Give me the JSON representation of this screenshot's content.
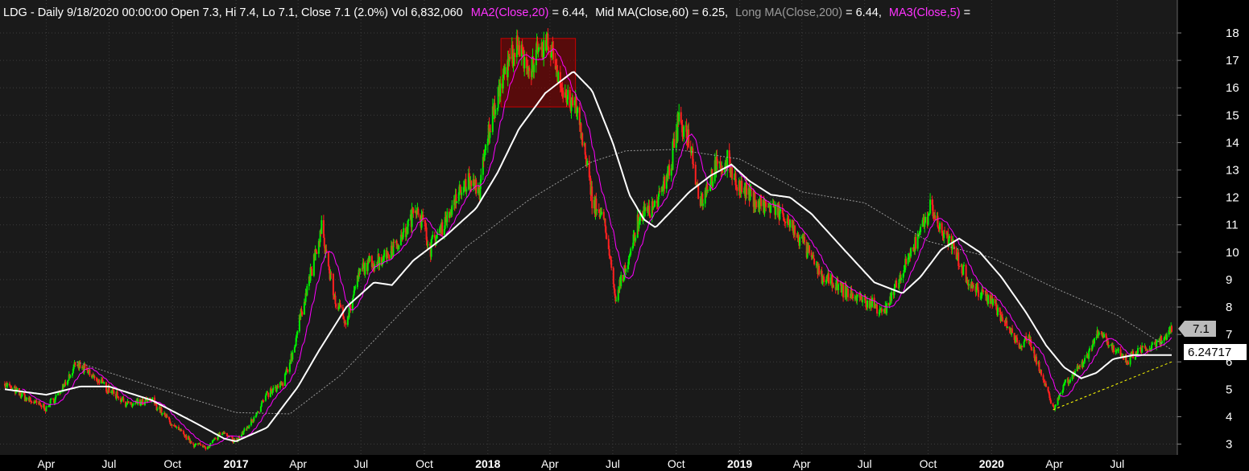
{
  "header": {
    "ticker_info": "LDG - Daily 9/18/2020 00:00:00 Open 7.3, Hi 7.4, Lo 7.1, Close 7.1 (2.0%) Vol 6,832,060",
    "ma2_label": "MA2(Close,20)",
    "ma2_value": " = 6.44,",
    "mid_label": "Mid MA(Close,60)",
    "mid_value": " = 6.25,",
    "long_label": "Long MA(Close,200)",
    "long_value": " = 6.44,",
    "ma3_label": "MA3(Close,5)",
    "ma3_value": " ="
  },
  "price_tags": {
    "last_close": "7.1",
    "mid_ma": "6.24717"
  },
  "colors": {
    "up_candle": "#00ee00",
    "down_candle": "#ff2020",
    "ma2": "#ff00ff",
    "mid_ma": "#ffffff",
    "long_ma": "#999999",
    "ma3": "#ff00ff",
    "trendline": "#ffff00",
    "highlight_box": "#aa0000"
  },
  "chart_data": {
    "type": "candlestick",
    "ylim": [
      2.6,
      18.6
    ],
    "y_ticks": [
      3,
      4,
      5,
      6,
      7,
      8,
      9,
      10,
      11,
      12,
      13,
      14,
      15,
      16,
      17,
      18
    ],
    "x_ticks": [
      "Apr",
      "Jul",
      "Oct",
      "2017",
      "Apr",
      "Jul",
      "Oct",
      "2018",
      "Apr",
      "Jul",
      "Oct",
      "2019",
      "Apr",
      "Jul",
      "Oct",
      "2020",
      "Apr",
      "Jul"
    ],
    "x_ticks_bold": [
      false,
      false,
      false,
      true,
      false,
      false,
      false,
      true,
      false,
      false,
      false,
      true,
      false,
      false,
      false,
      true,
      false,
      false
    ],
    "x_tick_dates": [
      "2016-04-01",
      "2016-07-01",
      "2016-10-01",
      "2017-01-01",
      "2017-04-01",
      "2017-07-01",
      "2017-10-01",
      "2018-01-01",
      "2018-04-01",
      "2018-07-01",
      "2018-10-01",
      "2019-01-01",
      "2019-04-01",
      "2019-07-01",
      "2019-10-01",
      "2020-01-01",
      "2020-04-01",
      "2020-07-01"
    ],
    "x_range": [
      "2016-02-01",
      "2020-09-18"
    ],
    "price_path": [
      [
        "2016-02-01",
        5.2
      ],
      [
        "2016-03-01",
        4.7
      ],
      [
        "2016-04-01",
        4.3
      ],
      [
        "2016-04-20",
        4.9
      ],
      [
        "2016-05-15",
        5.9
      ],
      [
        "2016-06-01",
        5.6
      ],
      [
        "2016-07-01",
        5.0
      ],
      [
        "2016-08-01",
        4.4
      ],
      [
        "2016-09-01",
        4.6
      ],
      [
        "2016-10-01",
        3.7
      ],
      [
        "2016-11-01",
        3.0
      ],
      [
        "2016-11-20",
        2.9
      ],
      [
        "2016-12-10",
        3.4
      ],
      [
        "2017-01-01",
        3.1
      ],
      [
        "2017-01-20",
        3.7
      ],
      [
        "2017-02-15",
        4.8
      ],
      [
        "2017-03-10",
        5.2
      ],
      [
        "2017-03-25",
        6.4
      ],
      [
        "2017-04-10",
        8.3
      ],
      [
        "2017-05-05",
        10.8
      ],
      [
        "2017-05-25",
        8.2
      ],
      [
        "2017-06-10",
        7.5
      ],
      [
        "2017-07-01",
        9.4
      ],
      [
        "2017-08-01",
        9.8
      ],
      [
        "2017-09-01",
        10.6
      ],
      [
        "2017-09-20",
        11.7
      ],
      [
        "2017-10-10",
        10.2
      ],
      [
        "2017-11-01",
        11.2
      ],
      [
        "2017-12-01",
        12.6
      ],
      [
        "2017-12-20",
        12.3
      ],
      [
        "2018-01-01",
        14.2
      ],
      [
        "2018-01-20",
        16.3
      ],
      [
        "2018-02-10",
        17.4
      ],
      [
        "2018-03-01",
        16.8
      ],
      [
        "2018-04-01",
        17.6
      ],
      [
        "2018-04-20",
        15.8
      ],
      [
        "2018-05-10",
        15.2
      ],
      [
        "2018-06-01",
        12.0
      ],
      [
        "2018-06-20",
        11.0
      ],
      [
        "2018-07-05",
        8.2
      ],
      [
        "2018-07-20",
        9.5
      ],
      [
        "2018-08-10",
        11.3
      ],
      [
        "2018-09-01",
        11.8
      ],
      [
        "2018-09-20",
        12.8
      ],
      [
        "2018-10-05",
        14.8
      ],
      [
        "2018-10-20",
        14.2
      ],
      [
        "2018-11-05",
        11.8
      ],
      [
        "2018-11-25",
        13.0
      ],
      [
        "2018-12-15",
        13.3
      ],
      [
        "2019-01-01",
        12.3
      ],
      [
        "2019-02-01",
        11.8
      ],
      [
        "2019-03-01",
        11.4
      ],
      [
        "2019-04-01",
        10.4
      ],
      [
        "2019-05-01",
        9.1
      ],
      [
        "2019-06-01",
        8.6
      ],
      [
        "2019-07-01",
        8.2
      ],
      [
        "2019-08-01",
        7.9
      ],
      [
        "2019-09-01",
        9.6
      ],
      [
        "2019-09-20",
        10.9
      ],
      [
        "2019-10-05",
        11.6
      ],
      [
        "2019-10-20",
        10.8
      ],
      [
        "2019-11-10",
        10.0
      ],
      [
        "2019-12-01",
        8.8
      ],
      [
        "2020-01-01",
        8.3
      ],
      [
        "2020-01-20",
        7.4
      ],
      [
        "2020-02-10",
        6.6
      ],
      [
        "2020-02-25",
        6.8
      ],
      [
        "2020-03-15",
        5.4
      ],
      [
        "2020-04-01",
        4.3
      ],
      [
        "2020-04-15",
        5.2
      ],
      [
        "2020-05-01",
        5.6
      ],
      [
        "2020-05-20",
        6.3
      ],
      [
        "2020-06-05",
        7.2
      ],
      [
        "2020-06-20",
        6.6
      ],
      [
        "2020-07-15",
        6.0
      ],
      [
        "2020-08-01",
        6.4
      ],
      [
        "2020-08-20",
        6.5
      ],
      [
        "2020-09-05",
        6.8
      ],
      [
        "2020-09-18",
        7.1
      ]
    ],
    "long_ma_path": [
      [
        "2016-05-15",
        6.0
      ],
      [
        "2016-09-01",
        5.1
      ],
      [
        "2017-01-01",
        4.15
      ],
      [
        "2017-03-20",
        4.1
      ],
      [
        "2017-06-01",
        5.5
      ],
      [
        "2017-09-01",
        7.9
      ],
      [
        "2017-12-01",
        10.2
      ],
      [
        "2018-03-01",
        11.9
      ],
      [
        "2018-06-01",
        13.3
      ],
      [
        "2018-07-20",
        13.7
      ],
      [
        "2018-10-01",
        13.75
      ],
      [
        "2019-01-01",
        13.4
      ],
      [
        "2019-04-01",
        12.2
      ],
      [
        "2019-07-01",
        11.8
      ],
      [
        "2019-10-01",
        10.4
      ],
      [
        "2020-01-01",
        9.8
      ],
      [
        "2020-04-01",
        8.7
      ],
      [
        "2020-07-01",
        7.7
      ],
      [
        "2020-09-18",
        6.44
      ]
    ],
    "mid_ma_path": [
      [
        "2016-02-01",
        5.0
      ],
      [
        "2016-04-01",
        4.8
      ],
      [
        "2016-05-20",
        5.1
      ],
      [
        "2016-07-01",
        5.1
      ],
      [
        "2016-09-01",
        4.6
      ],
      [
        "2016-11-01",
        3.8
      ],
      [
        "2016-12-15",
        3.2
      ],
      [
        "2017-01-01",
        3.1
      ],
      [
        "2017-02-15",
        3.6
      ],
      [
        "2017-04-01",
        5.1
      ],
      [
        "2017-05-01",
        6.4
      ],
      [
        "2017-06-10",
        8.0
      ],
      [
        "2017-07-20",
        8.9
      ],
      [
        "2017-08-15",
        8.8
      ],
      [
        "2017-09-15",
        9.7
      ],
      [
        "2017-11-01",
        10.6
      ],
      [
        "2017-12-15",
        11.6
      ],
      [
        "2018-01-15",
        12.9
      ],
      [
        "2018-02-15",
        14.5
      ],
      [
        "2018-03-25",
        15.8
      ],
      [
        "2018-05-05",
        16.6
      ],
      [
        "2018-06-01",
        15.9
      ],
      [
        "2018-07-01",
        14.0
      ],
      [
        "2018-07-25",
        12.1
      ],
      [
        "2018-08-15",
        11.2
      ],
      [
        "2018-09-01",
        10.9
      ],
      [
        "2018-09-20",
        11.4
      ],
      [
        "2018-10-20",
        12.2
      ],
      [
        "2018-11-20",
        12.8
      ],
      [
        "2018-12-20",
        13.2
      ],
      [
        "2019-01-15",
        12.6
      ],
      [
        "2019-02-15",
        12.1
      ],
      [
        "2019-03-15",
        12.0
      ],
      [
        "2019-04-15",
        11.4
      ],
      [
        "2019-06-01",
        10.1
      ],
      [
        "2019-07-15",
        8.9
      ],
      [
        "2019-08-25",
        8.5
      ],
      [
        "2019-09-20",
        9.1
      ],
      [
        "2019-10-20",
        10.1
      ],
      [
        "2019-11-15",
        10.5
      ],
      [
        "2019-12-15",
        10.0
      ],
      [
        "2020-01-15",
        9.1
      ],
      [
        "2020-02-20",
        7.8
      ],
      [
        "2020-03-20",
        6.6
      ],
      [
        "2020-04-15",
        5.8
      ],
      [
        "2020-05-10",
        5.4
      ],
      [
        "2020-06-01",
        5.6
      ],
      [
        "2020-06-25",
        6.1
      ],
      [
        "2020-07-25",
        6.25
      ],
      [
        "2020-09-18",
        6.25
      ]
    ],
    "trendline": [
      [
        "2020-03-30",
        4.25
      ],
      [
        "2020-09-18",
        6.0
      ]
    ]
  }
}
